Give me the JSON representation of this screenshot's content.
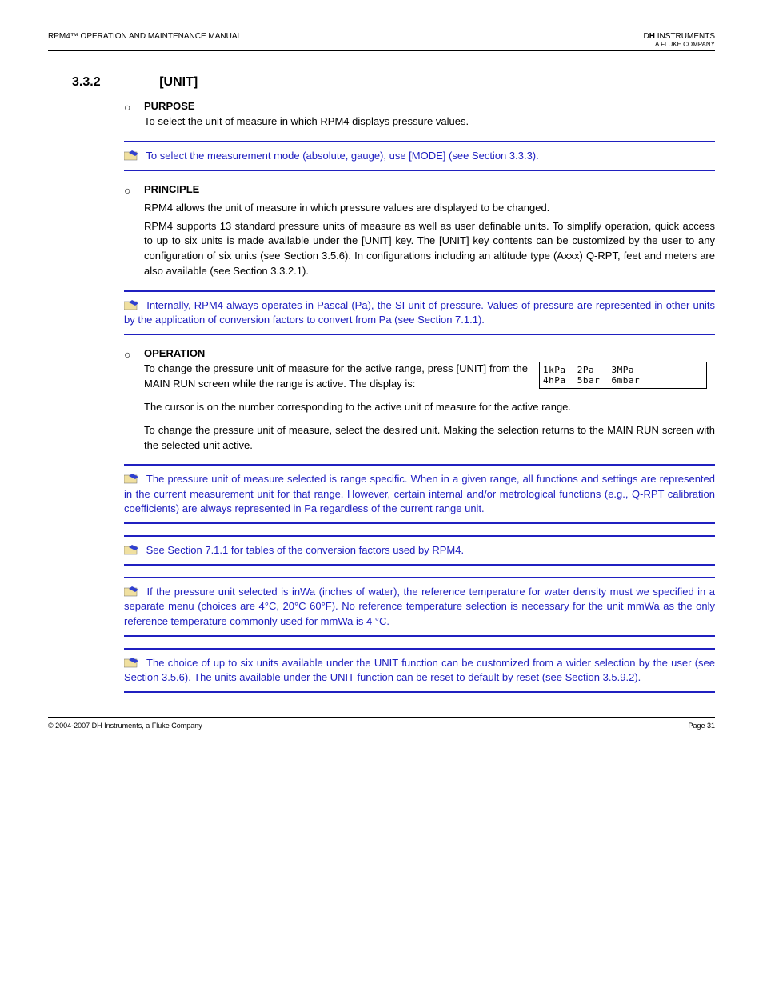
{
  "header": {
    "left": "RPM4™ OPERATION AND MAINTENANCE MANUAL",
    "right": "DH INSTRUMENTS\nA FLUKE COMPANY"
  },
  "section": {
    "number": "3.3.2",
    "title": "[UNIT]"
  },
  "purpose": {
    "label": "PURPOSE",
    "text": "To select the unit of measure in which RPM4 displays pressure values."
  },
  "note1": "To select the measurement mode (absolute, gauge), use [MODE] (see Section 3.3.3).",
  "principle": {
    "label": "PRINCIPLE",
    "para1": "RPM4 allows the unit of measure in which pressure values are displayed to be changed.",
    "para2": "RPM4 supports 13 standard pressure units of measure as well as user definable units. To simplify operation, quick access to up to six units is made available under the [UNIT] key. The [UNIT] key contents can be customized by the user to any configuration of six units (see Section 3.5.6). In configurations including an altitude type (Axxx) Q-RPT, feet and meters are also available (see Section 3.3.2.1)."
  },
  "note2": "Internally, RPM4 always operates in Pascal (Pa), the SI unit of pressure. Values of pressure are represented in other units by the application of conversion factors to convert from Pa (see Section 7.1.1).",
  "operation": {
    "label": "OPERATION",
    "para1": "To change the pressure unit of measure for the active range, press [UNIT] from the MAIN RUN screen while the range is active. The display is:",
    "screen": {
      "line1": "1kPa  2Pa   3MPa",
      "line2": "4hPa  5bar  6mbar"
    },
    "para2": "The cursor is on the number corresponding to the active unit of measure for the active range.",
    "para3": "To change the pressure unit of measure, select the desired unit. Making the selection returns to the MAIN RUN screen with the selected unit active."
  },
  "note3": "The pressure unit of measure selected is range specific. When in a given range, all functions and settings are represented in the current measurement unit for that range. However, certain internal and/or metrological functions (e.g., Q-RPT calibration coefficients) are always represented in Pa regardless of the current range unit.",
  "note4_prefix": "See Section 7.1.1 for tables of the ",
  "note4_em": "conversion",
  "note4_suffix": " factors used by RPM4.",
  "note5": "If the pressure unit selected is inWa (inches of water), the reference temperature for water density must we specified in a separate menu (choices are 4°C, 20°C 60°F). No reference temperature selection is necessary for the unit mmWa as the only reference temperature commonly used for mmWa is 4 °C.",
  "note6": "The choice of up to six units available under the UNIT function can be customized from a wider selection by the user (see Section 3.5.6). The units available under the UNIT function can be reset to default by reset (see Section 3.5.9.2).",
  "footer": {
    "copy": "© 2004-2007 DH Instruments, a Fluke Company",
    "page": "Page 31"
  }
}
